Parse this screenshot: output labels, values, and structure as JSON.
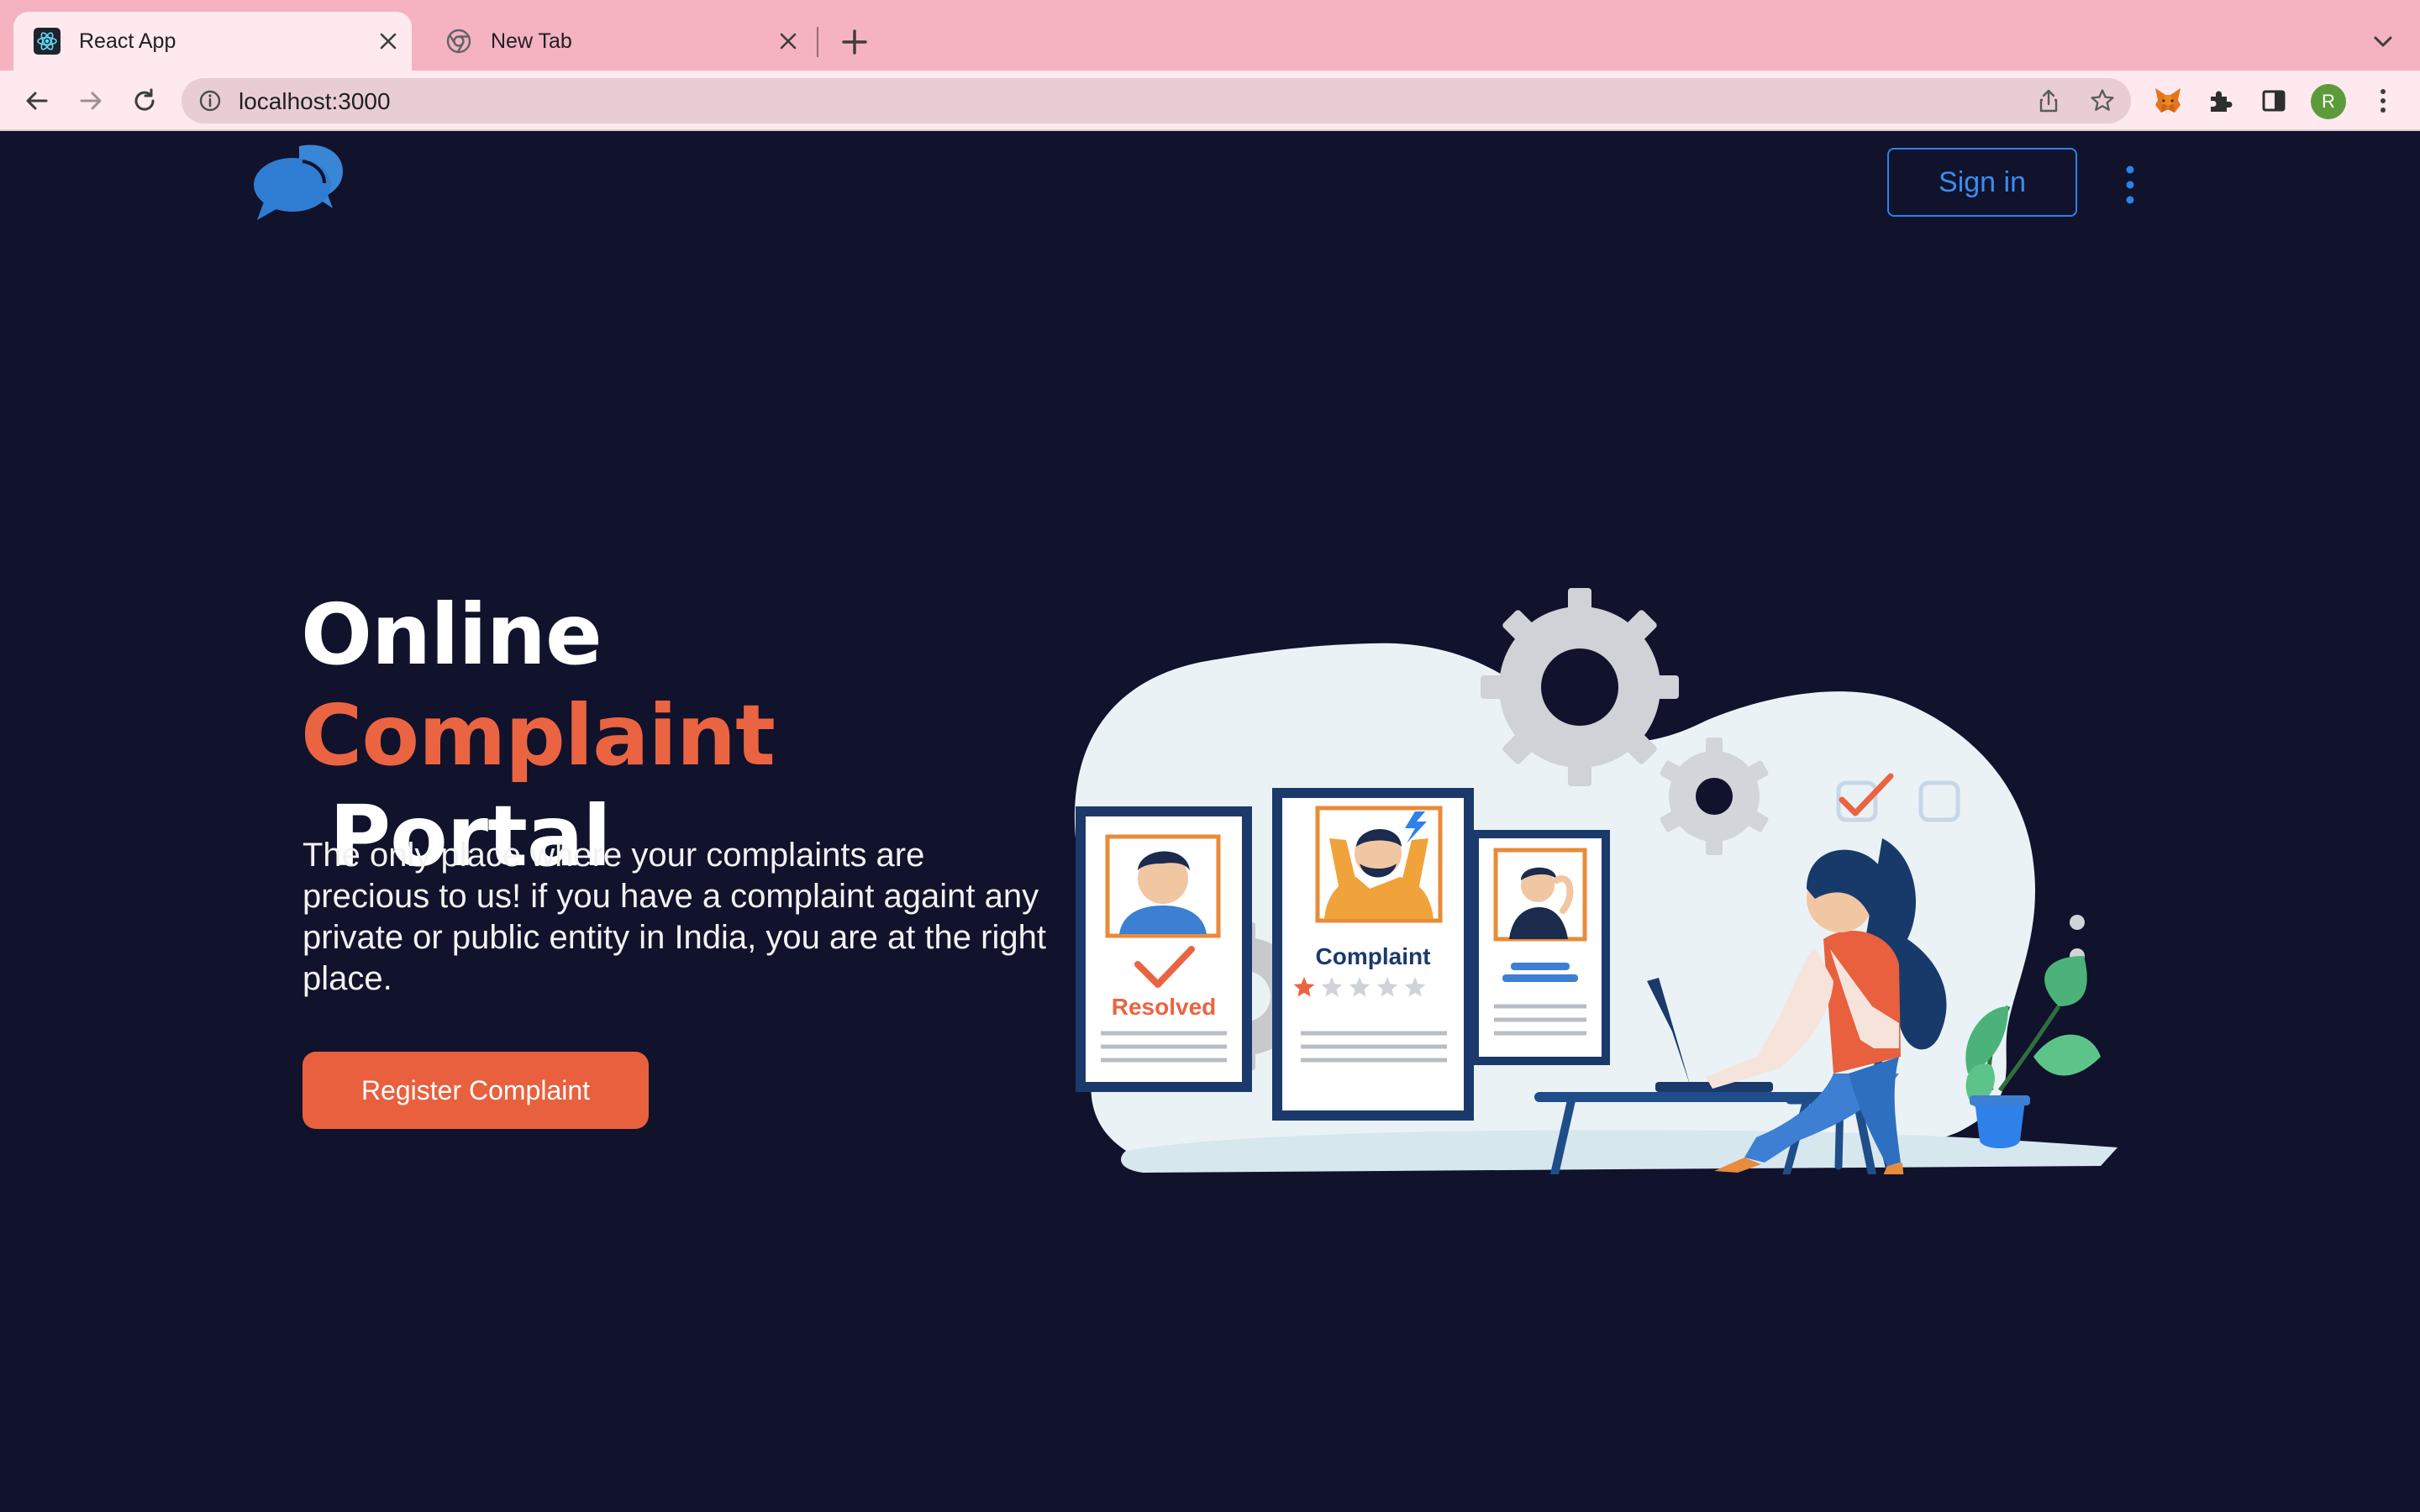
{
  "browser": {
    "tabs": [
      {
        "title": "React App",
        "favicon": "react-icon",
        "active": true
      },
      {
        "title": "New Tab",
        "favicon": "chrome-icon",
        "active": false
      }
    ],
    "url": "localhost:3000",
    "profile_initial": "R"
  },
  "header": {
    "logo": "chat-bubbles-logo",
    "signin_label": "Sign in"
  },
  "hero": {
    "title_line1": "Online",
    "title_accent": "Complaint",
    "title_rest": " Portal",
    "description": "The only place where your complaints are precious to us! if you have a complaint againt any private or public entity in India, you are at the right place.",
    "cta_label": "Register Complaint"
  },
  "illustration": {
    "card_left_label": "Resolved",
    "card_middle_label": "Complaint",
    "rating_filled": 1,
    "rating_total": 5
  },
  "colors": {
    "background": "#11122b",
    "accent": "#ea6442",
    "primary_blue": "#2f81ea",
    "tabstrip": "#f5b2c1"
  }
}
